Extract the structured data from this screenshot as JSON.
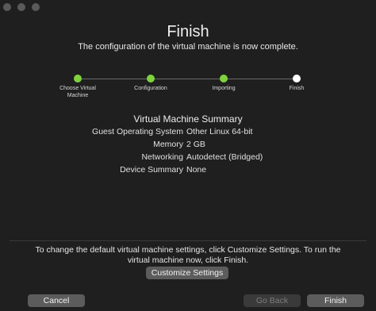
{
  "window": {
    "title": "Finish",
    "subtitle": "The configuration of the virtual machine is now complete."
  },
  "steps": [
    {
      "label": "Choose Virtual Machine",
      "state": "done"
    },
    {
      "label": "Configuration",
      "state": "done"
    },
    {
      "label": "Importing",
      "state": "done"
    },
    {
      "label": "Finish",
      "state": "current"
    }
  ],
  "summary": {
    "title": "Virtual Machine Summary",
    "rows": [
      {
        "key": "Guest Operating System",
        "value": "Other Linux 64-bit"
      },
      {
        "key": "Memory",
        "value": "2 GB"
      },
      {
        "key": "Networking",
        "value": "Autodetect (Bridged)"
      },
      {
        "key": "Device Summary",
        "value": "None"
      }
    ]
  },
  "info_text": "To change the default virtual machine settings, click Customize Settings. To run the virtual machine now, click Finish.",
  "buttons": {
    "customize": "Customize Settings",
    "cancel": "Cancel",
    "go_back": "Go Back",
    "finish": "Finish"
  },
  "colors": {
    "step_done": "#7fd23e",
    "step_current": "#ffffff",
    "background": "#1f1f1f"
  }
}
